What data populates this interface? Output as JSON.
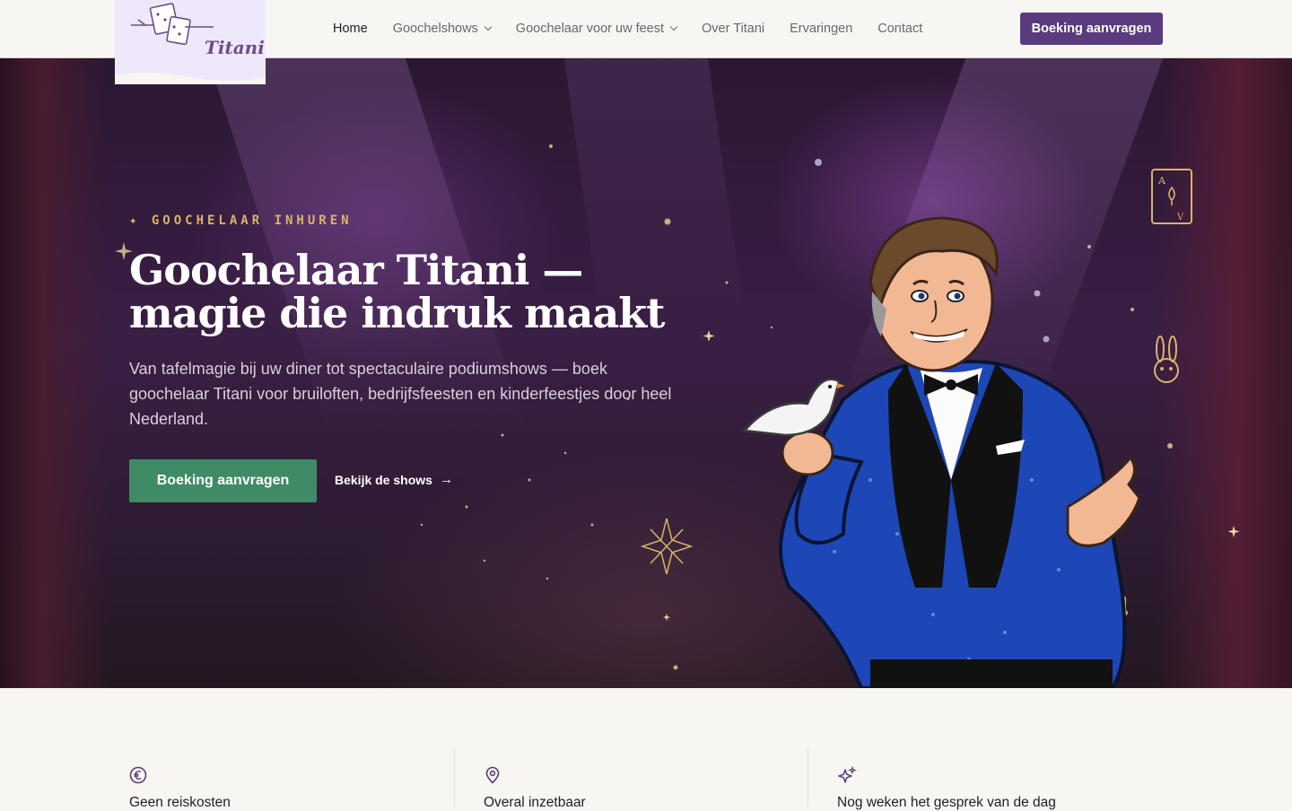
{
  "header": {
    "logo_alt": "Titani",
    "nav": [
      {
        "label": "Home",
        "active": true,
        "dropdown": false
      },
      {
        "label": "Goochelshows",
        "active": false,
        "dropdown": true
      },
      {
        "label": "Goochelaar voor uw feest",
        "active": false,
        "dropdown": true
      },
      {
        "label": "Over Titani",
        "active": false,
        "dropdown": false
      },
      {
        "label": "Ervaringen",
        "active": false,
        "dropdown": false
      },
      {
        "label": "Contact",
        "active": false,
        "dropdown": false
      }
    ],
    "cta_label": "Boeking aanvragen"
  },
  "hero": {
    "eyebrow": "✦ GOOCHELAAR INHUREN",
    "title": "Goochelaar Titani — magie die indruk maakt",
    "subtitle": "Van tafelmagie bij uw diner tot spectaculaire podiumshows — boek goochelaar Titani voor bruiloften, bedrijfsfeesten en kinderfeestjes door heel Nederland.",
    "primary_button": "Boeking aanvragen",
    "secondary_link": "Bekijk de shows",
    "secondary_icon": "arrow-right-icon"
  },
  "features": [
    {
      "icon": "euro-icon",
      "title": "Geen reiskosten"
    },
    {
      "icon": "map-pin-icon",
      "title": "Overal inzetbaar"
    },
    {
      "icon": "sparkles-icon",
      "title": "Nog weken het gesprek van de dag"
    }
  ],
  "colors": {
    "brand_purple": "#5a3b7d",
    "cta_green": "#3e8b65",
    "eyebrow_gold": "#d9b36a",
    "page_bg": "#f8f6f2"
  }
}
